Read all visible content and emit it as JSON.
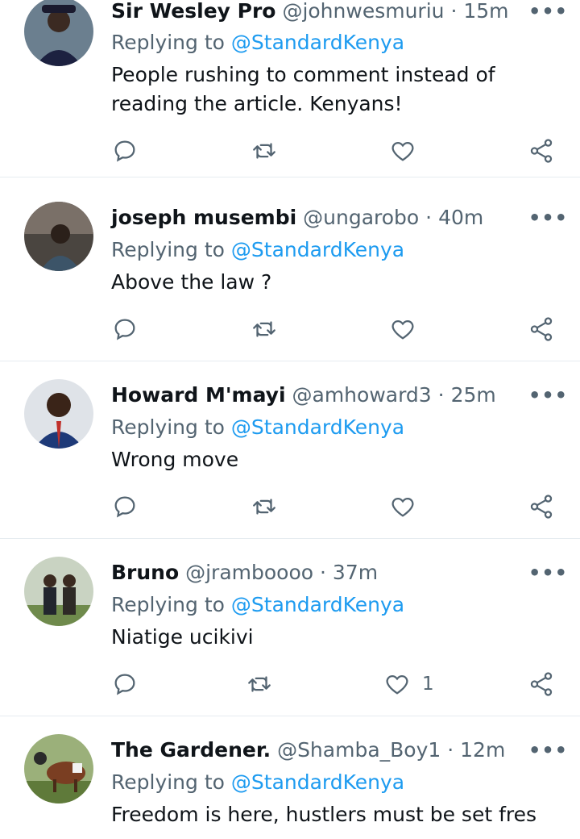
{
  "colors": {
    "link": "#1d9bf0",
    "secondary": "#536471",
    "text": "#0f1419",
    "divider": "#e6ecf0"
  },
  "tweets": [
    {
      "name": "Sir Wesley Pro",
      "handle": "@johnwesmuriu",
      "time": "15m",
      "replying_label": "Replying to",
      "replying_handle": "@StandardKenya",
      "text": "People rushing to comment instead of reading the article. Kenyans!",
      "like_count": ""
    },
    {
      "name": "joseph musembi",
      "handle": "@ungarobo",
      "time": "40m",
      "replying_label": "Replying to",
      "replying_handle": "@StandardKenya",
      "text": "Above the law ?",
      "like_count": ""
    },
    {
      "name": "Howard M'mayi",
      "handle": "@amhoward3",
      "time": "25m",
      "replying_label": "Replying to",
      "replying_handle": "@StandardKenya",
      "text": "Wrong move",
      "like_count": ""
    },
    {
      "name": "Bruno",
      "handle": "@jramboooo",
      "time": "37m",
      "replying_label": "Replying to",
      "replying_handle": "@StandardKenya",
      "text": "Niatige ucikivi",
      "like_count": "1"
    },
    {
      "name": "The Gardener.",
      "handle": "@Shamba_Boy1",
      "time": "12m",
      "replying_label": "Replying to",
      "replying_handle": "@StandardKenya",
      "text": "Freedom is here, hustlers must be set fres",
      "like_count": ""
    }
  ],
  "separator": "·",
  "more_glyph": "•••",
  "icons": {
    "reply": "reply-icon",
    "retweet": "retweet-icon",
    "like": "heart-icon",
    "share": "share-icon",
    "more": "more-icon"
  }
}
